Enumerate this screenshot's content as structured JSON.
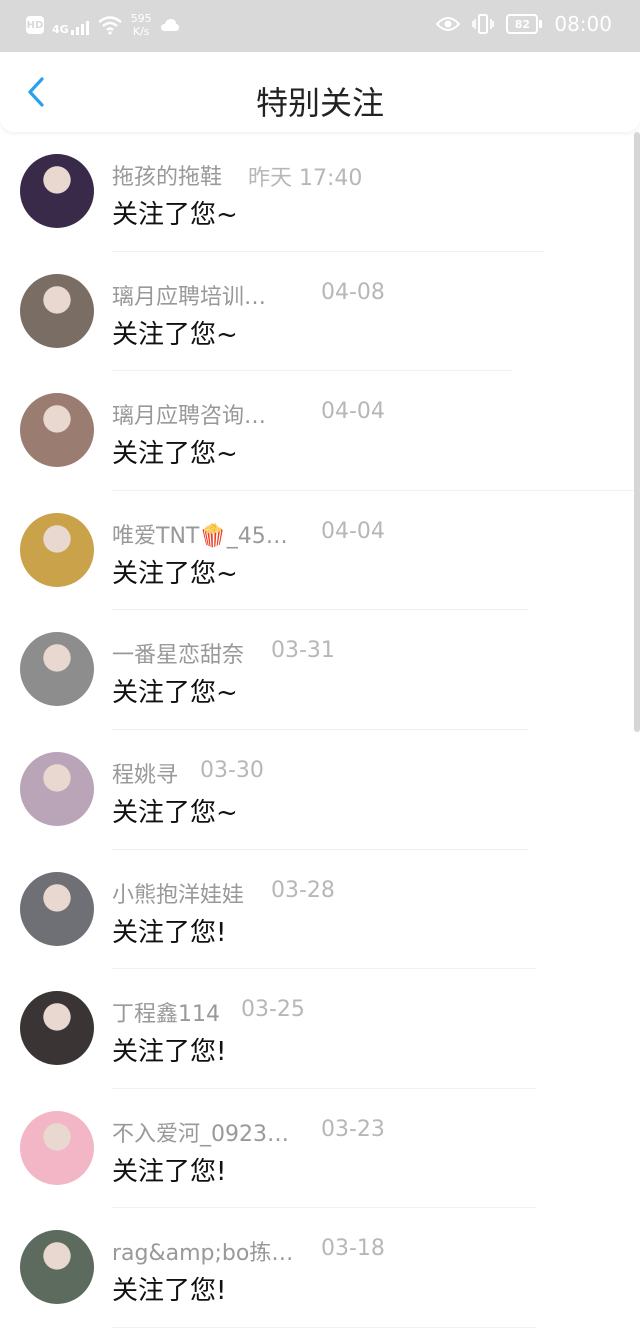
{
  "status_bar": {
    "hd": "HD",
    "network": "4G",
    "speed_value": "595",
    "speed_unit": "K/s",
    "battery": "82",
    "time": "08:00"
  },
  "header": {
    "title": "特别关注",
    "back_icon": "chevron-left-icon"
  },
  "items": [
    {
      "name": "拖孩的拖鞋",
      "date": "昨天 17:40",
      "message": "关注了您~",
      "avatar_color": "#3a2a4a"
    },
    {
      "name": "璃月应聘培训…",
      "date": "04-08",
      "message": "关注了您~",
      "avatar_color": "#7a6e64"
    },
    {
      "name": "璃月应聘咨询…",
      "date": "04-04",
      "message": "关注了您~",
      "avatar_color": "#9a7c70"
    },
    {
      "name": "唯爱TNT🍿_45…",
      "date": "04-04",
      "message": "关注了您~",
      "avatar_color": "#c9a24a"
    },
    {
      "name": "一番星恋甜奈",
      "date": "03-31",
      "message": "关注了您~",
      "avatar_color": "#8d8d8d"
    },
    {
      "name": "程姚寻",
      "date": "03-30",
      "message": "关注了您~",
      "avatar_color": "#b9a4b8"
    },
    {
      "name": "小熊抱洋娃娃",
      "date": "03-28",
      "message": "关注了您!",
      "avatar_color": "#6f6f76"
    },
    {
      "name": "丁程鑫114",
      "date": "03-25",
      "message": "关注了您!",
      "avatar_color": "#3a3434"
    },
    {
      "name": "不入爱河_0923…",
      "date": "03-23",
      "message": "关注了您!",
      "avatar_color": "#f3b6c6"
    },
    {
      "name": "rag&amp;bo拣…",
      "date": "03-18",
      "message": "关注了您!",
      "avatar_color": "#5d6a5e"
    }
  ]
}
